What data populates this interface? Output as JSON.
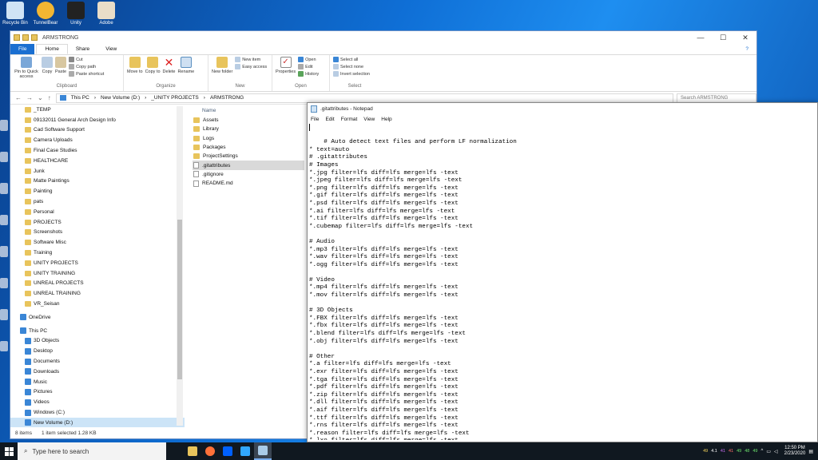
{
  "desktop": {
    "icons": [
      {
        "label": "Recycle Bin",
        "icon": "recycle-bin-icon",
        "color": "#cfe3f5"
      },
      {
        "label": "TunnelBear",
        "icon": "tunnelbear-icon",
        "color": "#f2b632"
      },
      {
        "label": "Unity",
        "icon": "unity-icon",
        "color": "#222222"
      },
      {
        "label": "Adobe",
        "icon": "adobe-icon",
        "color": "#e9ddc8"
      }
    ]
  },
  "explorer": {
    "title": "ARMSTRONG",
    "tabs": {
      "file": "File",
      "home": "Home",
      "share": "Share",
      "view": "View"
    },
    "ribbon": {
      "clipboard": {
        "label": "Clipboard",
        "pin": "Pin to Quick access",
        "copy": "Copy",
        "paste": "Paste",
        "cut": "Cut",
        "copy_path": "Copy path",
        "paste_shortcut": "Paste shortcut"
      },
      "organize": {
        "label": "Organize",
        "move_to": "Move to",
        "copy_to": "Copy to",
        "delete": "Delete",
        "rename": "Rename"
      },
      "new": {
        "label": "New",
        "new_folder": "New folder",
        "new_item": "New item",
        "easy_access": "Easy access"
      },
      "open": {
        "label": "Open",
        "properties": "Properties",
        "open": "Open",
        "edit": "Edit",
        "history": "History"
      },
      "select": {
        "label": "Select",
        "select_all": "Select all",
        "select_none": "Select none",
        "invert": "Invert selection"
      }
    },
    "address": {
      "crumbs": [
        "This PC",
        "New Volume (D:)",
        "_UNITY PROJECTS",
        "ARMSTRONG"
      ],
      "search_placeholder": "Search ARMSTRONG"
    },
    "nav_items": [
      "_TEMP",
      "09132011 General Arch Design Info",
      "Cad Software Support",
      "Camera Uploads",
      "Final Case Studies",
      "HEALTHCARE",
      "Junk",
      "Matte Paintings",
      "Painting",
      "pats",
      "Personal",
      "PROJECTS",
      "Screenshots",
      "Software Misc",
      "Training",
      "UNITY PROJECTS",
      "UNITY TRAINING",
      "UNREAL PROJECTS",
      "UNREAL TRAINING",
      "VR_Seisan"
    ],
    "nav_roots": {
      "onedrive": "OneDrive",
      "this_pc": "This PC"
    },
    "pc_items": [
      "3D Objects",
      "Desktop",
      "Documents",
      "Downloads",
      "Music",
      "Pictures",
      "Videos",
      "Windows (C:)",
      "New Volume (D:)"
    ],
    "column_name": "Name",
    "files": [
      {
        "name": "Assets",
        "type": "folder"
      },
      {
        "name": "Library",
        "type": "folder"
      },
      {
        "name": "Logs",
        "type": "folder"
      },
      {
        "name": "Packages",
        "type": "folder"
      },
      {
        "name": "ProjectSettings",
        "type": "folder"
      },
      {
        "name": ".gitattributes",
        "type": "file"
      },
      {
        "name": ".gitignore",
        "type": "file"
      },
      {
        "name": "README.md",
        "type": "file"
      }
    ],
    "status": {
      "items": "8 items",
      "selected": "1 item selected  1.28 KB"
    }
  },
  "notepad": {
    "title": ".gitattributes - Notepad",
    "menu": [
      "File",
      "Edit",
      "Format",
      "View",
      "Help"
    ],
    "text": "# Auto detect text files and perform LF normalization\n* text=auto\n# .gitattributes\n# Images\n*.jpg filter=lfs diff=lfs merge=lfs -text\n*.jpeg filter=lfs diff=lfs merge=lfs -text\n*.png filter=lfs diff=lfs merge=lfs -text\n*.gif filter=lfs diff=lfs merge=lfs -text\n*.psd filter=lfs diff=lfs merge=lfs -text\n*.ai filter=lfs diff=lfs merge=lfs -text\n*.tif filter=lfs diff=lfs merge=lfs -text\n*.cubemap filter=lfs diff=lfs merge=lfs -text\n\n# Audio\n*.mp3 filter=lfs diff=lfs merge=lfs -text\n*.wav filter=lfs diff=lfs merge=lfs -text\n*.ogg filter=lfs diff=lfs merge=lfs -text\n\n# Video\n*.mp4 filter=lfs diff=lfs merge=lfs -text\n*.mov filter=lfs diff=lfs merge=lfs -text\n\n# 3D Objects\n*.FBX filter=lfs diff=lfs merge=lfs -text\n*.fbx filter=lfs diff=lfs merge=lfs -text\n*.blend filter=lfs diff=lfs merge=lfs -text\n*.obj filter=lfs diff=lfs merge=lfs -text\n\n# Other\n*.a filter=lfs diff=lfs merge=lfs -text\n*.exr filter=lfs diff=lfs merge=lfs -text\n*.tga filter=lfs diff=lfs merge=lfs -text\n*.pdf filter=lfs diff=lfs merge=lfs -text\n*.zip filter=lfs diff=lfs merge=lfs -text\n*.dll filter=lfs diff=lfs merge=lfs -text\n*.aif filter=lfs diff=lfs merge=lfs -text\n*.ttf filter=lfs diff=lfs merge=lfs -text\n*.rns filter=lfs diff=lfs merge=lfs -text\n*.reason filter=lfs diff=lfs merge=lfs -text\n*.lxo filter=lfs diff=lfs merge=lfs -text"
  },
  "taskbar": {
    "search_placeholder": "Type here to search",
    "apps": [
      {
        "icon": "file-explorer-icon",
        "color": "#e8c45c"
      },
      {
        "icon": "firefox-icon",
        "color": "#ff7139"
      },
      {
        "icon": "dropbox-icon",
        "color": "#0061fe"
      },
      {
        "icon": "photoshop-icon",
        "color": "#31a8ff"
      },
      {
        "icon": "notepad-icon",
        "color": "#a9cbe8"
      }
    ],
    "tray_numbers": [
      "49",
      "4.1",
      "41",
      "41",
      "49",
      "48",
      "49"
    ],
    "time": "12:50 PM",
    "date": "2/23/2020"
  }
}
